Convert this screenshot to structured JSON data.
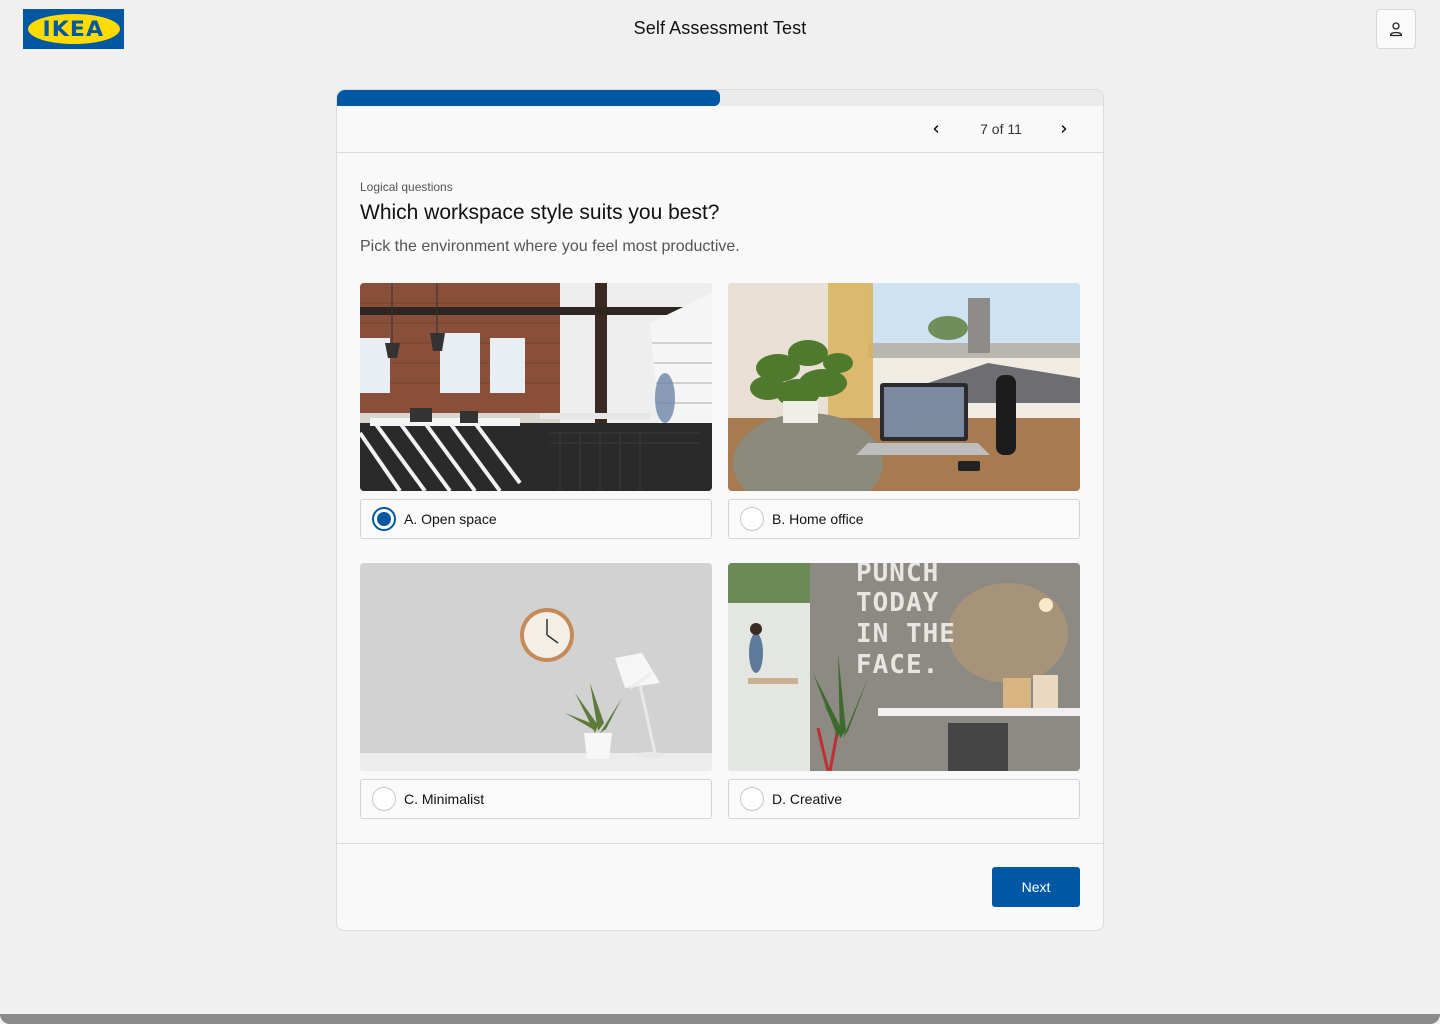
{
  "header": {
    "logo_text": "IKEA",
    "title": "Self Assessment Test",
    "profile_icon": "user-icon"
  },
  "progress": {
    "current": 7,
    "total": 11,
    "label": "7 of 11",
    "fill_fraction": 0.5
  },
  "question": {
    "category": "Logical questions",
    "title": "Which workspace style suits you best?",
    "subtitle": "Pick the environment where you feel most productive."
  },
  "options": [
    {
      "label": "A. Open space",
      "selected": true
    },
    {
      "label": "B. Home office",
      "selected": false
    },
    {
      "label": "C. Minimalist",
      "selected": false
    },
    {
      "label": "D. Creative",
      "selected": false
    }
  ],
  "decor": {
    "wall_text_lines": [
      "PUNCH",
      "TODAY",
      "IN THE",
      "FACE."
    ]
  },
  "footer": {
    "next_label": "Next"
  },
  "colors": {
    "brand_blue": "#0058a3",
    "brand_yellow": "#ffdb00",
    "background": "#f0f0f0"
  }
}
